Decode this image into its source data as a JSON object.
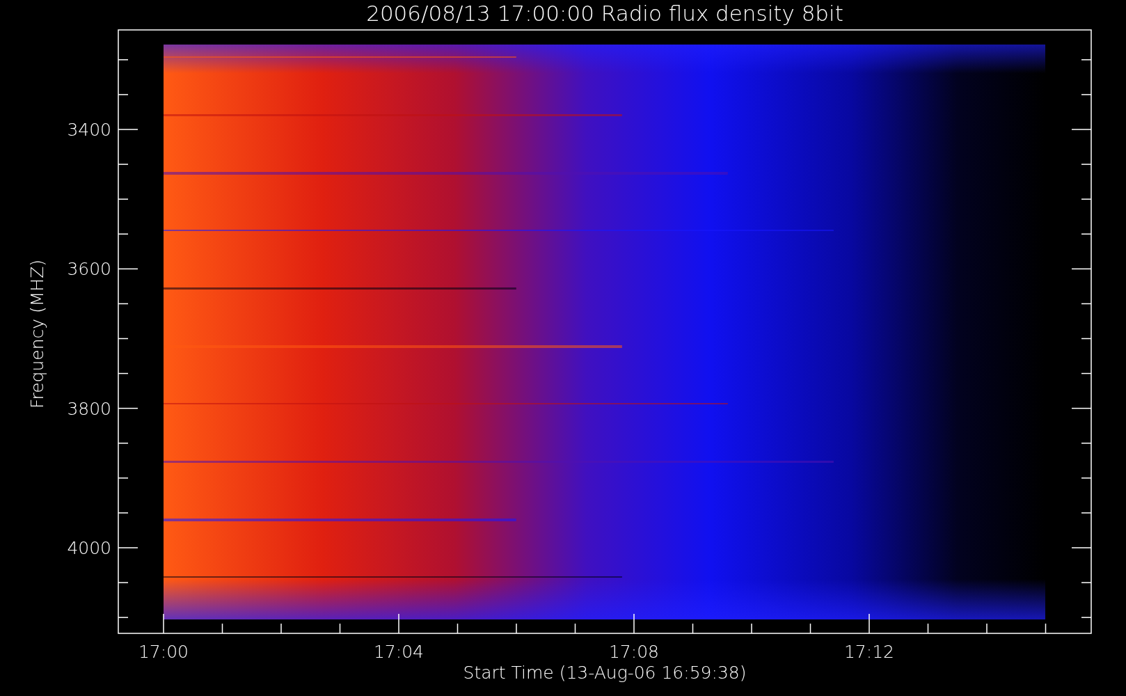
{
  "title": "2006/08/13 17:00:00 Radio flux density 8bit",
  "y_axis": {
    "label": "Frequency (MHZ)",
    "ticks": [
      "3400",
      "3600",
      "3800",
      "4000"
    ]
  },
  "x_axis": {
    "label": "Start Time (13-Aug-06 16:59:38)",
    "ticks": [
      "17:00",
      "17:04",
      "17:08",
      "17:12"
    ]
  }
}
